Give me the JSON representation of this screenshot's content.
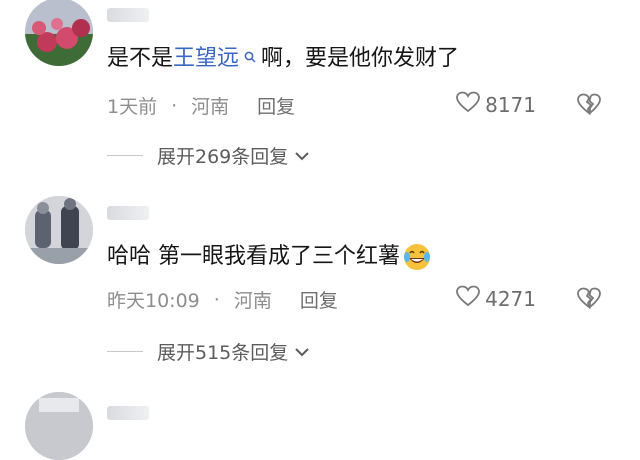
{
  "comments": [
    {
      "text_before": "是不是",
      "link_text": "王望远",
      "text_after": "啊，要是他你发财了",
      "time": "1天前",
      "separator": "·",
      "location": "河南",
      "reply_label": "回复",
      "likes": "8171",
      "expand_label": "展开269条回复"
    },
    {
      "text": "哈哈 第一眼我看成了三个红薯",
      "emoji": "laughing-tears-emoji",
      "time": "昨天10:09",
      "separator": "·",
      "location": "河南",
      "reply_label": "回复",
      "likes": "4271",
      "expand_label": "展开515条回复"
    }
  ],
  "icons": {
    "like": "heart-icon",
    "dislike": "broken-heart-icon",
    "expand": "chevron-down-icon",
    "link": "search-icon"
  },
  "colors": {
    "link": "#3a66c4",
    "meta": "#8e8e8e"
  }
}
